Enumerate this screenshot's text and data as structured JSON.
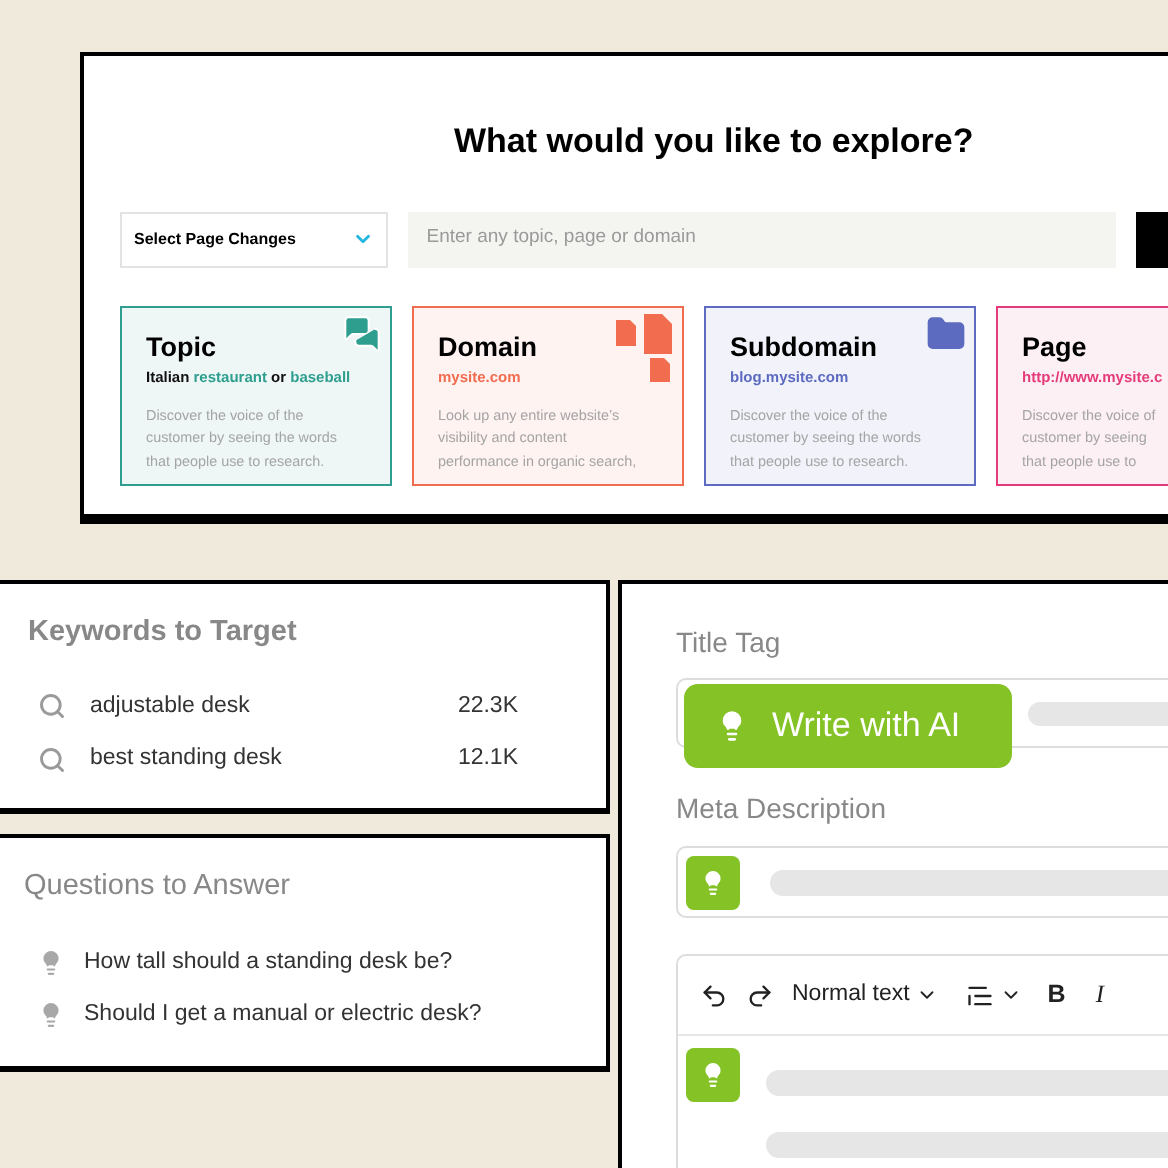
{
  "explore": {
    "title": "What would you like to explore?",
    "select": {
      "value": "Select Page Changes"
    },
    "search": {
      "placeholder": "Enter any topic, page or domain"
    },
    "cards": [
      {
        "kind": "topic",
        "title": "Topic",
        "color": "#2e9e8f",
        "subtitle": [
          {
            "text": "Italian ",
            "highlight": false
          },
          {
            "text": "restaurant",
            "highlight": true
          },
          {
            "text": " or ",
            "highlight": false
          },
          {
            "text": "baseball",
            "highlight": true
          }
        ],
        "description": [
          "Discover the voice of the",
          "customer by seeing the words",
          "that people use to research."
        ]
      },
      {
        "kind": "domain",
        "title": "Domain",
        "color": "#f26c4f",
        "subtitle": [
          {
            "text": "mysite.com",
            "highlight": true
          }
        ],
        "description": [
          "Look up any entire website’s",
          "visibility and content",
          "performance in organic search,"
        ]
      },
      {
        "kind": "subdomain",
        "title": "Subdomain",
        "color": "#5c6bc0",
        "subtitle": [
          {
            "text": "blog.mysite.com",
            "highlight": true
          }
        ],
        "description": [
          "Discover the voice of the",
          "customer by seeing the words",
          "that people use to research."
        ]
      },
      {
        "kind": "page",
        "title": "Page",
        "color": "#e43b7a",
        "subtitle": [
          {
            "text": "http://www.mysite.c",
            "highlight": true
          }
        ],
        "description": [
          "Discover the voice of",
          "customer by seeing",
          "that people use to"
        ]
      }
    ]
  },
  "keywords": {
    "title": "Keywords to Target",
    "items": [
      {
        "text": "adjustable desk",
        "volume": "22.3K"
      },
      {
        "text": "best standing desk",
        "volume": "12.1K"
      }
    ]
  },
  "questions": {
    "title": "Questions to Answer",
    "items": [
      "How tall should a standing desk be?",
      "Should I get a manual or electric desk?"
    ]
  },
  "editor": {
    "title_label": "Title Tag",
    "ai_button": "Write with AI",
    "meta_label": "Meta Description",
    "toolbar": {
      "style": "Normal text",
      "bold": "B",
      "italic": "I"
    }
  }
}
